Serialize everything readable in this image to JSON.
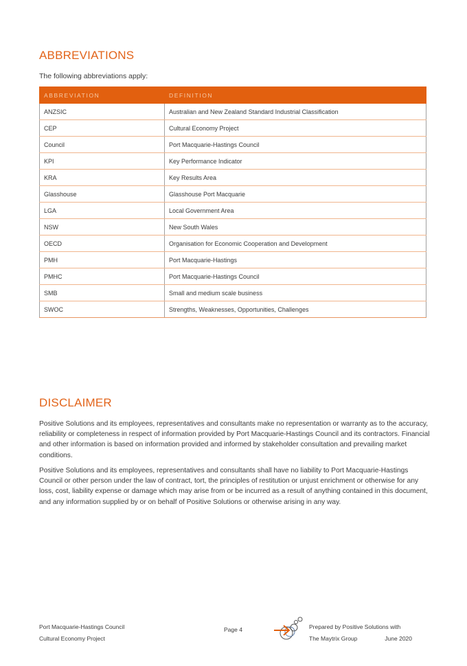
{
  "abbreviations": {
    "title": "ABBREVIATIONS",
    "intro": "The following abbreviations apply:",
    "columns": [
      "ABBREVIATION",
      "DEFINITION"
    ],
    "rows": [
      {
        "abbr": "ANZSIC",
        "definition": "Australian and New Zealand Standard Industrial Classification"
      },
      {
        "abbr": "CEP",
        "definition": "Cultural Economy Project"
      },
      {
        "abbr": "Council",
        "definition": "Port Macquarie-Hastings Council"
      },
      {
        "abbr": "KPI",
        "definition": "Key Performance Indicator"
      },
      {
        "abbr": "KRA",
        "definition": "Key Results Area"
      },
      {
        "abbr": "Glasshouse",
        "definition": "Glasshouse Port Macquarie"
      },
      {
        "abbr": "LGA",
        "definition": "Local Government Area"
      },
      {
        "abbr": "NSW",
        "definition": "New South Wales"
      },
      {
        "abbr": "OECD",
        "definition": "Organisation for Economic Cooperation and Development"
      },
      {
        "abbr": "PMH",
        "definition": "Port Macquarie-Hastings"
      },
      {
        "abbr": "PMHC",
        "definition": "Port Macquarie-Hastings Council"
      },
      {
        "abbr": "SMB",
        "definition": "Small and medium scale business"
      },
      {
        "abbr": "SWOC",
        "definition": "Strengths, Weaknesses, Opportunities, Challenges"
      }
    ]
  },
  "disclaimer": {
    "title": "DISCLAIMER",
    "paragraphs": [
      "Positive Solutions and its employees, representatives and consultants make no representation or warranty as to the accuracy, reliability or completeness in respect of information provided by Port Macquarie-Hastings Council and its contractors. Financial and other information is based on information provided and informed by stakeholder consultation and prevailing market conditions.",
      "Positive Solutions and its employees, representatives and consultants shall have no liability to Port Macquarie-Hastings Council or other person under the law of contract, tort, the principles of restitution or unjust enrichment or otherwise for any loss, cost, liability expense or damage which may arise from or be incurred as a result of anything contained in this document, and any information supplied by or on behalf of Positive Solutions or otherwise arising in any way."
    ]
  },
  "footer": {
    "client": "Port Macquarie-Hastings Council",
    "project": "Cultural Economy Project",
    "page": "Page 4",
    "logo_icon": "positive-solutions-logo",
    "prepared_by": "Prepared by Positive Solutions with",
    "partner": "The Maytrix Group",
    "date": "June 2020"
  },
  "colors": {
    "accent": "#e2600f",
    "heading": "#e2641a",
    "row_border": "#f0b58d",
    "text": "#3b3b3b"
  }
}
